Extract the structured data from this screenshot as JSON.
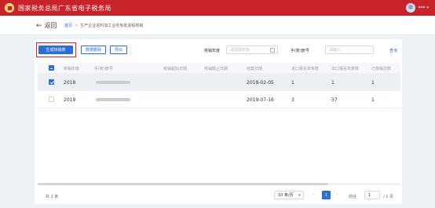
{
  "header": {
    "title": "国家税务总局广东省电子税务局",
    "user_name": "***"
  },
  "breadcrumb": {
    "back_label": "返回",
    "home": "首页",
    "current": "生产企业进料加工业务免抵退税核销"
  },
  "toolbar": {
    "generate_label": "生成核销表",
    "delete_label": "数据删除",
    "export_label": "导出"
  },
  "filters": {
    "year_label": "核销年度",
    "year_placeholder": "请选择年份",
    "handbook_label": "手(账)册号",
    "handbook_placeholder": "请输入",
    "query_label": "查询"
  },
  "table": {
    "columns": [
      "核销年度",
      "手(账)册号",
      "核销起始日期",
      "核销截止日期",
      "结案日期",
      "进口报关单条数",
      "出口报关单条数",
      "已核销次数"
    ],
    "rows": [
      {
        "selected": true,
        "year": "2018",
        "close_date": "2018-02-05",
        "import_count": "1",
        "export_count": "1",
        "verified_times": "1"
      },
      {
        "selected": false,
        "year": "2019",
        "close_date": "2019-07-16",
        "import_count": "3",
        "export_count": "37",
        "verified_times": "1"
      }
    ]
  },
  "pagination": {
    "total": "共 2 条",
    "page_size": "10 条/页",
    "current_page": "1",
    "goto_label": "前往",
    "goto_value": "1",
    "total_pages": "/ 1 页"
  }
}
